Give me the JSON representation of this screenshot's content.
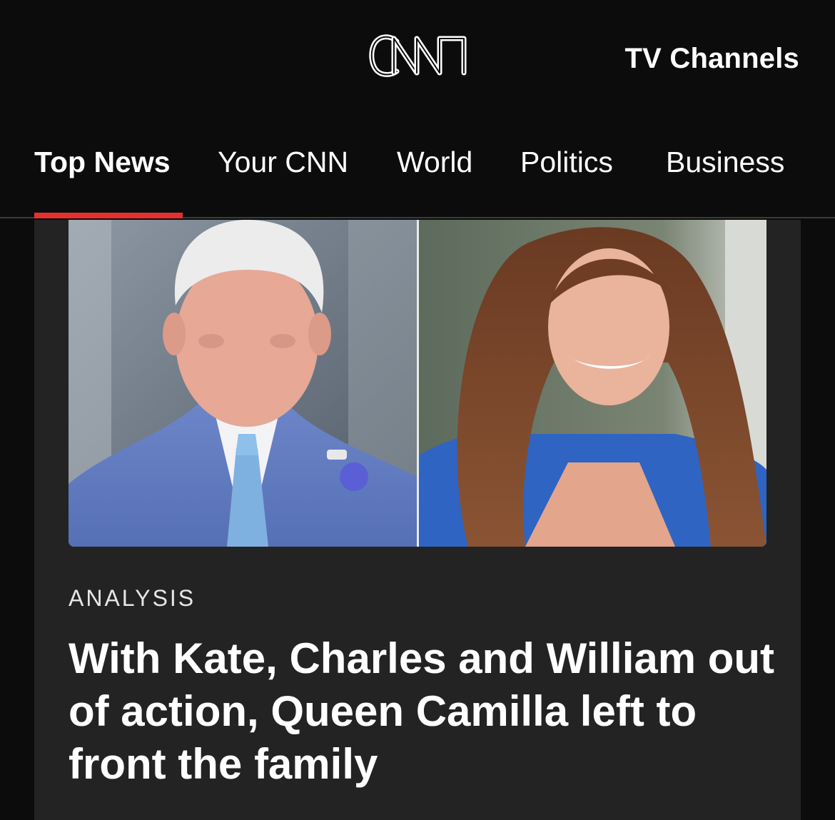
{
  "header": {
    "logo_text": "CNN",
    "tv_channels_label": "TV Channels"
  },
  "nav": {
    "items": [
      {
        "label": "Top News",
        "active": true
      },
      {
        "label": "Your CNN",
        "active": false
      },
      {
        "label": "World",
        "active": false
      },
      {
        "label": "Politics",
        "active": false
      },
      {
        "label": "Business",
        "active": false
      }
    ]
  },
  "story": {
    "kicker": "ANALYSIS",
    "headline": "With Kate, Charles and William out of action, Queen Camilla left to front the family"
  },
  "colors": {
    "background": "#0c0c0c",
    "card": "#232323",
    "accent": "#e5302e"
  }
}
